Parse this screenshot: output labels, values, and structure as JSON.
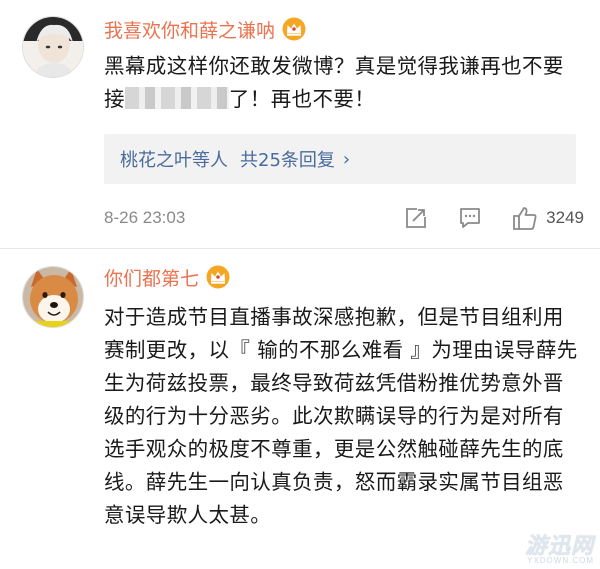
{
  "comments": [
    {
      "username": "我喜欢你和薛之谦呐",
      "avatar": "avatar-white-hair-person",
      "text_before_blur": "黑幕成这样你还敢发微博？真是觉得我谦再也不要接",
      "text_after_blur": "了！再也不要！",
      "replies": {
        "names": "桃花之叶等人",
        "count": "共25条回复",
        "arrow": "›"
      },
      "time": "8-26 23:03",
      "likes": "3249"
    },
    {
      "username": "你们都第七",
      "avatar": "avatar-shiba-dog",
      "text": "对于造成节目直播事故深感抱歉，但是节目组利用赛制更改，以『 输的不那么难看 』为理由误导薛先生为荷兹投票，最终导致荷兹凭借粉推优势意外晋级的行为十分恶劣。此次欺瞒误导的行为是对所有选手观众的极度不尊重，更是公然触碰薛先生的底线。薛先生一向认真负责，怒而霸录实属节目组恶意误导欺人太甚。"
    }
  ],
  "watermark": {
    "main": "游迅网",
    "sub": "YXDOWN.COM"
  },
  "colors": {
    "username": "#eb7350",
    "link": "#4a6b9c",
    "reply_bg": "#f2f2f2",
    "crown": "#f5a623"
  }
}
